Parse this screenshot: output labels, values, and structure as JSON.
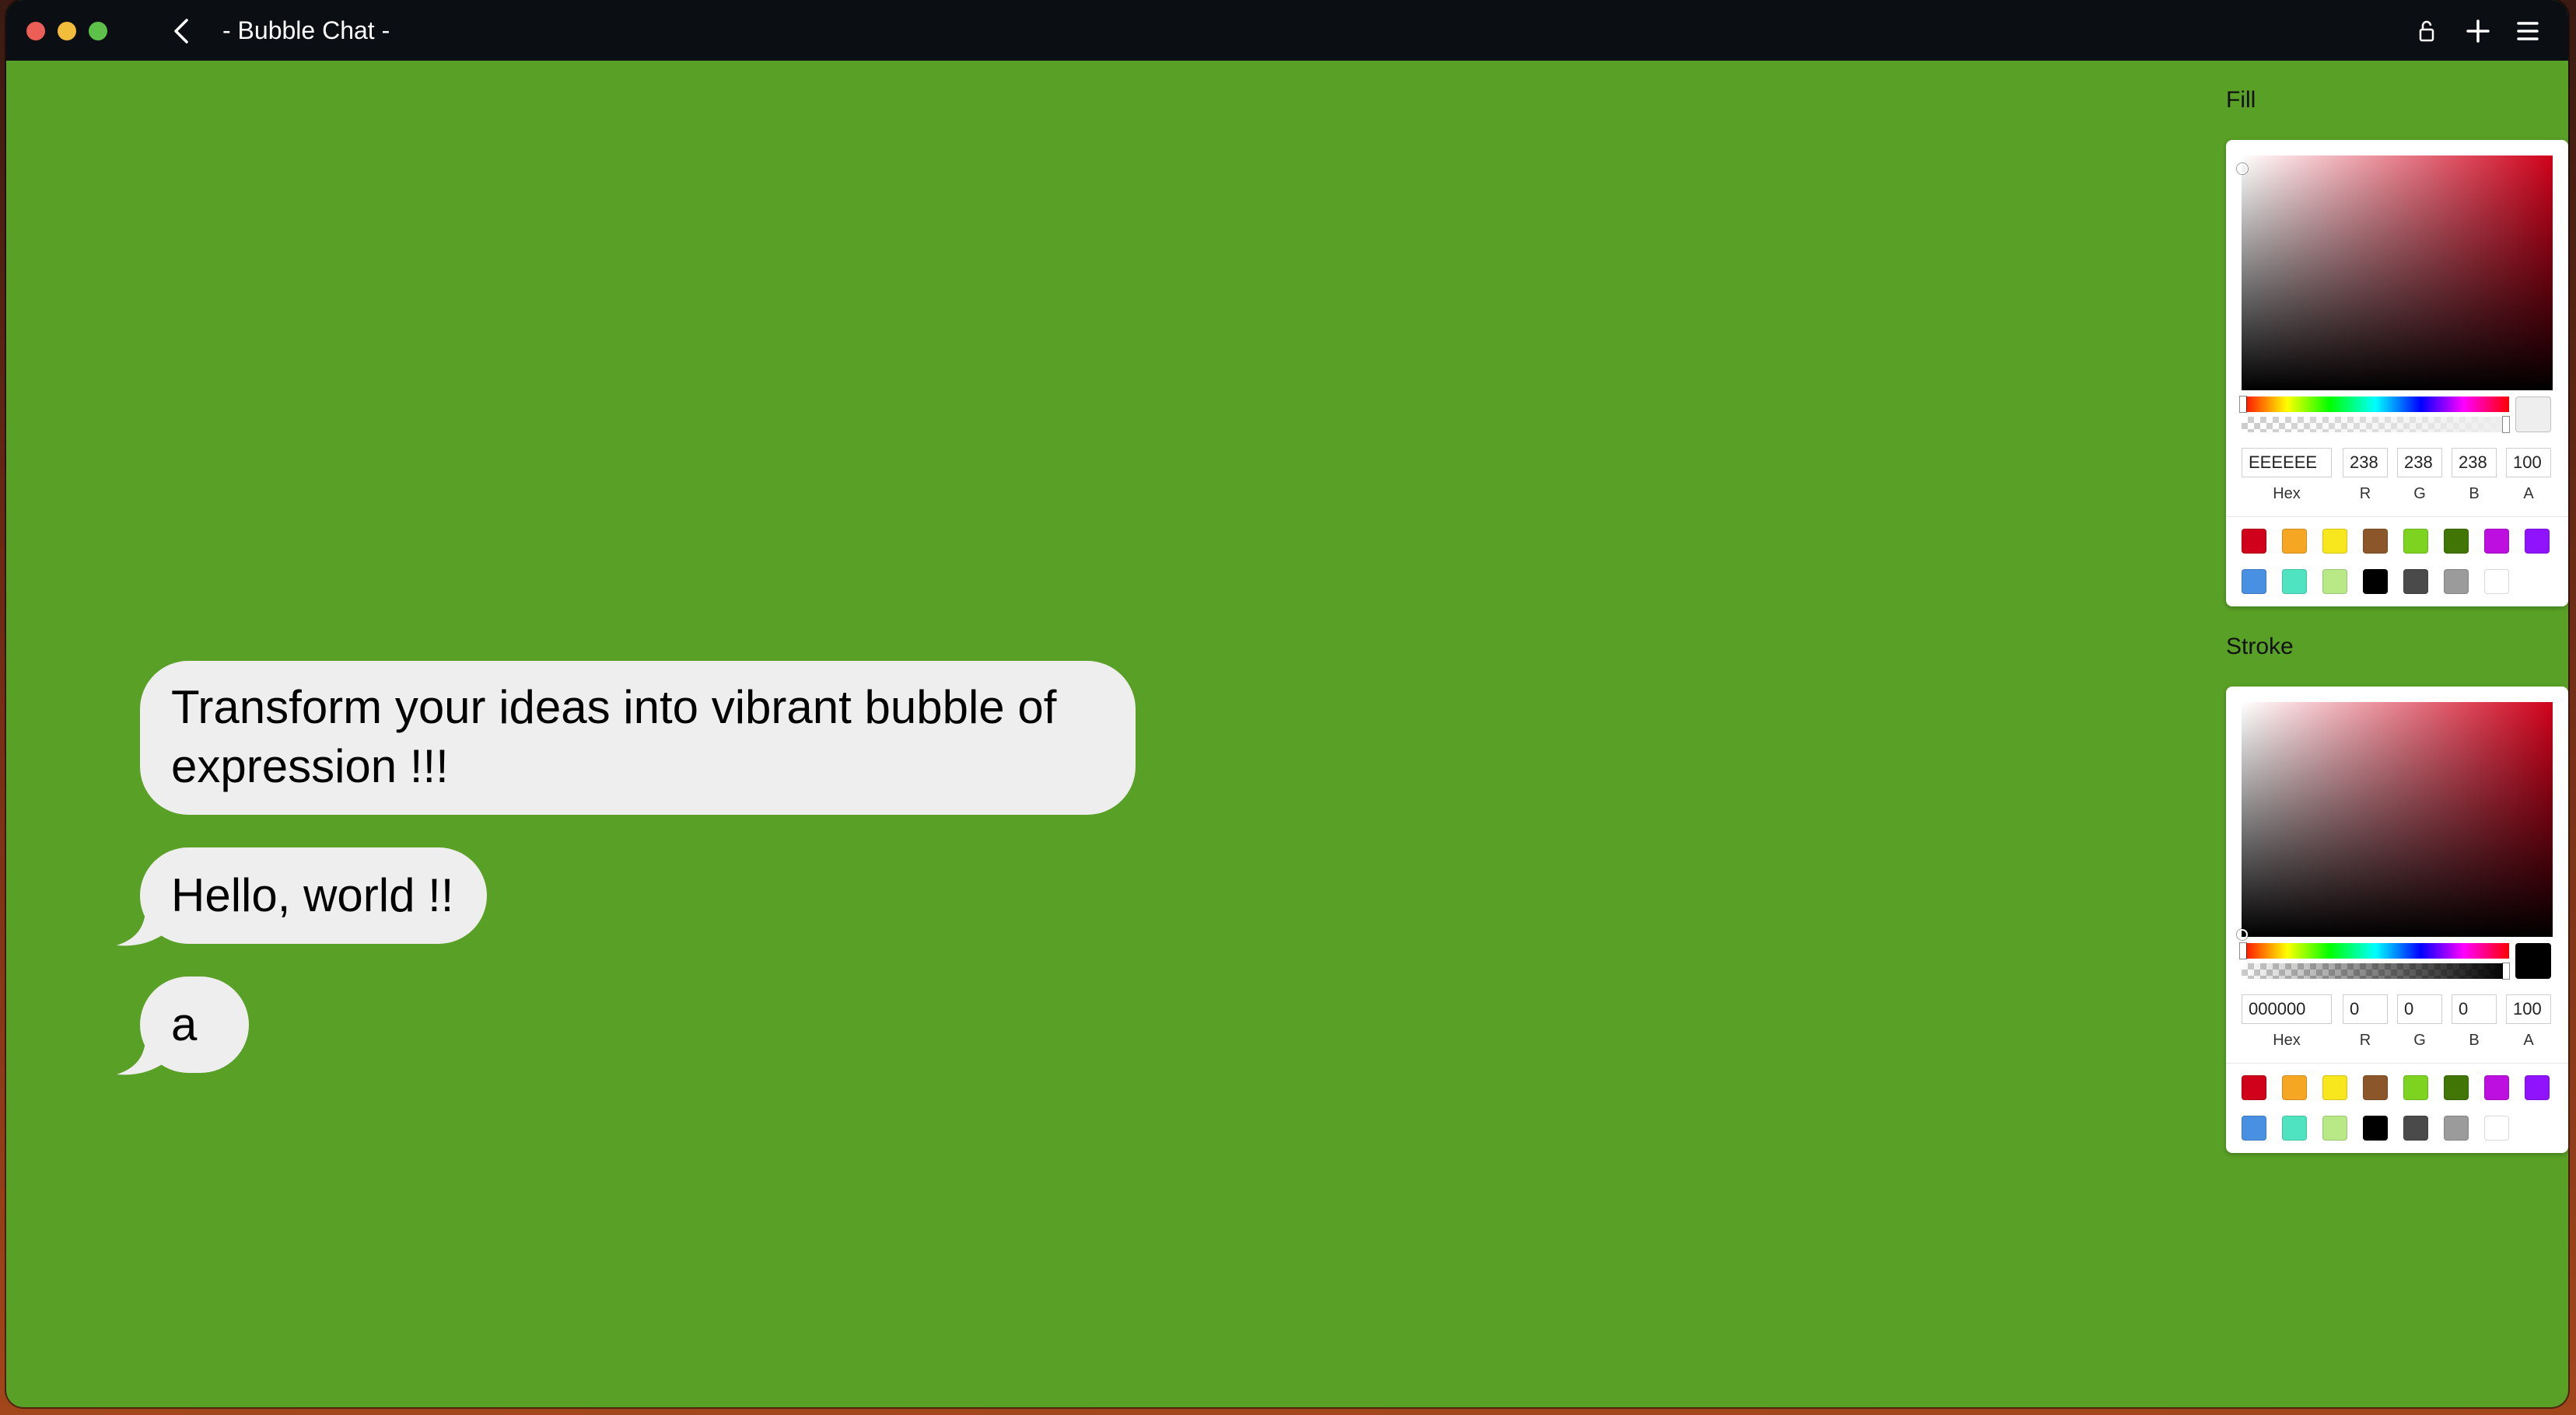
{
  "window": {
    "title": "- Bubble Chat -"
  },
  "toolbar": {
    "back": "chevron-left-icon",
    "lock": "lock-icon",
    "add": "plus-icon",
    "menu": "hamburger-menu-icon"
  },
  "canvas": {
    "background_color": "#59A026",
    "bubbles": [
      {
        "text": "Transform your ideas into vibrant bubble of expression !!!"
      },
      {
        "text": "Hello, world !!"
      },
      {
        "text": "a"
      }
    ]
  },
  "fill": {
    "label": "Fill",
    "hex": "EEEEEE",
    "r": "238",
    "g": "238",
    "b": "238",
    "a": "100",
    "color": "#EEEEEE",
    "labels": {
      "hex": "Hex",
      "r": "R",
      "g": "G",
      "b": "B",
      "a": "A"
    }
  },
  "stroke": {
    "label": "Stroke",
    "hex": "000000",
    "r": "0",
    "g": "0",
    "b": "0",
    "a": "100",
    "color": "#000000",
    "labels": {
      "hex": "Hex",
      "r": "R",
      "g": "G",
      "b": "B",
      "a": "A"
    }
  },
  "swatches": [
    "#D0021B",
    "#F5A623",
    "#F8E71C",
    "#8B572A",
    "#7ED321",
    "#417505",
    "#BD10E0",
    "#9013FE",
    "#4A90E2",
    "#50E3C2",
    "#B8E986",
    "#000000",
    "#4A4A4A",
    "#9B9B9B",
    "#FFFFFF"
  ]
}
